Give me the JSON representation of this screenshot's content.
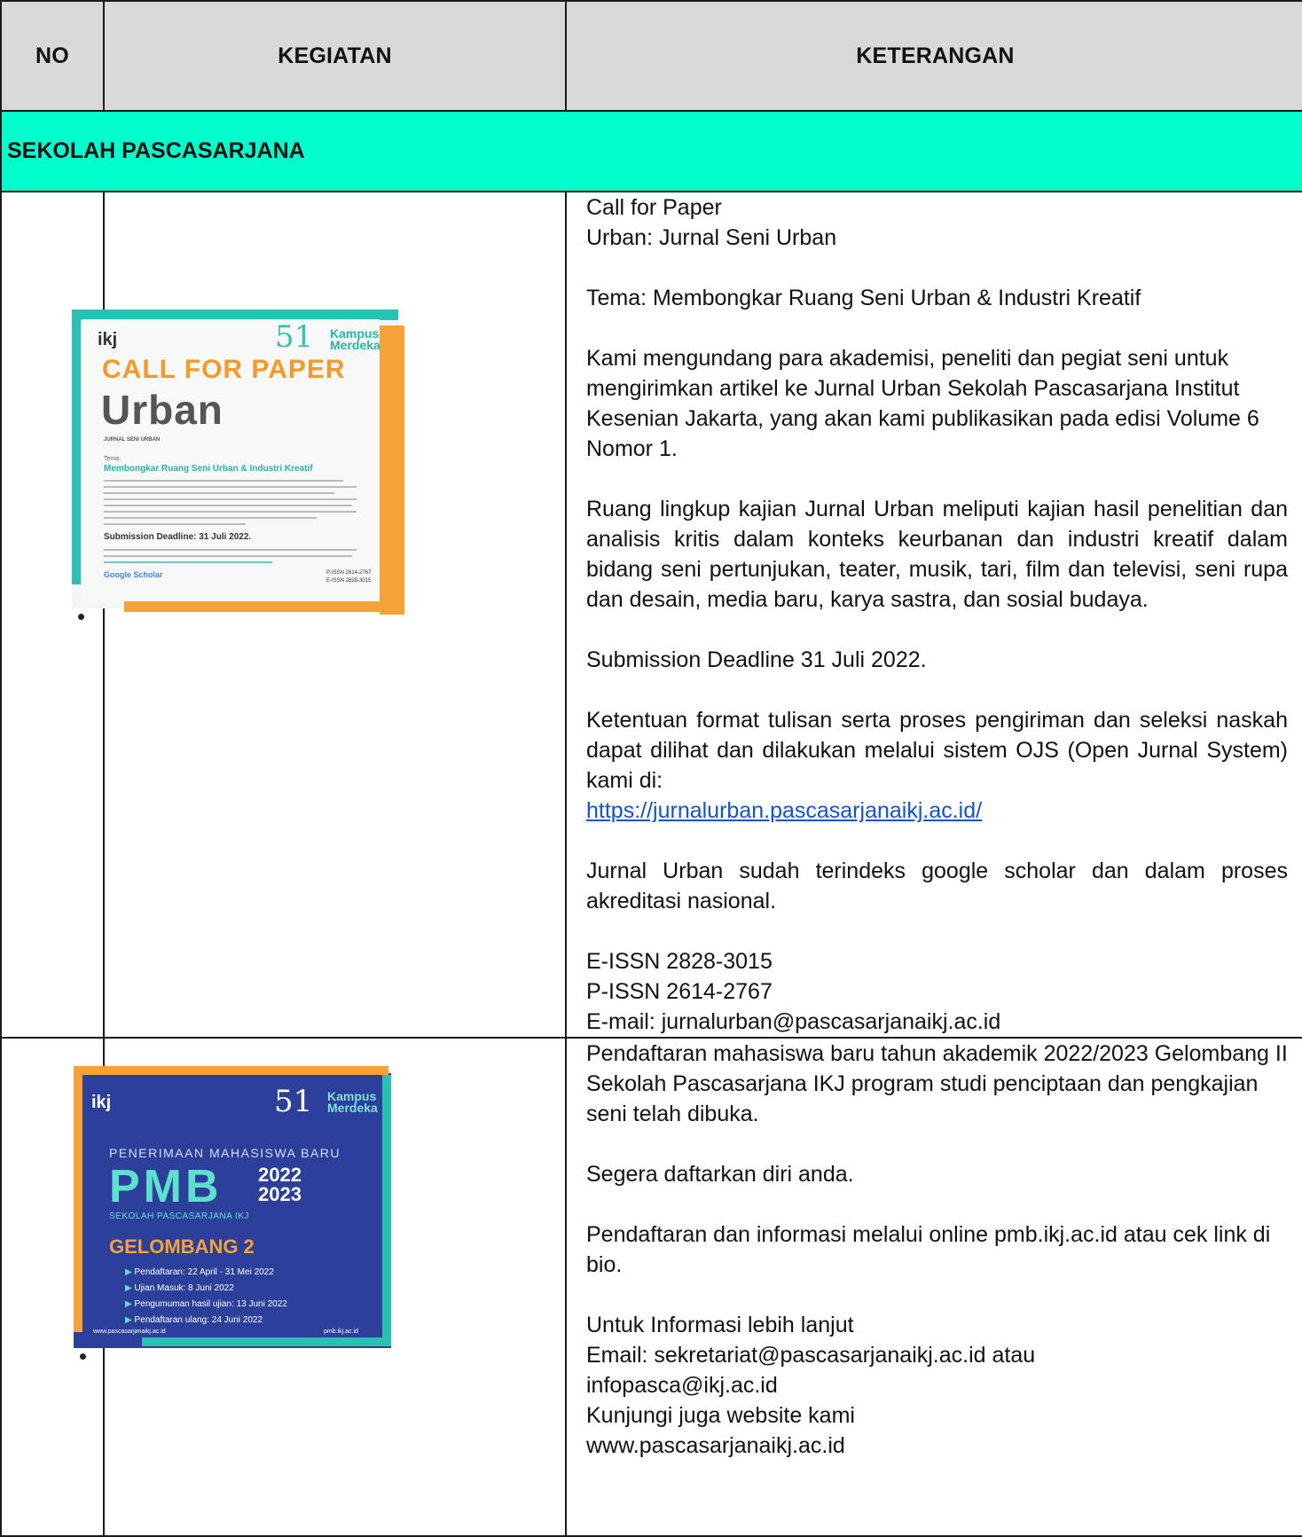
{
  "table": {
    "headers": {
      "no": "NO",
      "kegiatan": "KEGIATAN",
      "keterangan": "KETERANGAN"
    },
    "section_title": "SEKOLAH PASCASARJANA",
    "row1": {
      "lines": {
        "l1": "Call for Paper",
        "l2": "Urban: Jurnal Seni Urban",
        "tema": "Tema: Membongkar Ruang Seni Urban & Industri Kreatif",
        "invite": "Kami mengundang para akademisi, peneliti dan pegiat seni untuk mengirimkan artikel ke Jurnal Urban Sekolah Pascasarjana Institut Kesenian Jakarta, yang akan kami publikasikan pada edisi Volume 6 Nomor 1.",
        "scope": "Ruang lingkup kajian Jurnal Urban meliputi kajian hasil penelitian dan analisis kritis dalam konteks keurbanan dan industri kreatif dalam bidang seni pertunjukan, teater, musik, tari, film dan televisi, seni rupa dan desain, media baru, karya sastra, dan sosial budaya.",
        "deadline": "Submission Deadline 31 Juli 2022.",
        "format": "Ketentuan format tulisan serta proses pengiriman dan seleksi naskah dapat dilihat dan dilakukan melalui sistem OJS (Open Jurnal System) kami di:",
        "link": "https://jurnalurban.pascasarjanaikj.ac.id/",
        "index": "Jurnal Urban sudah terindeks google scholar dan dalam proses akreditasi nasional.",
        "eissn": "E-ISSN 2828-3015",
        "pissn": "P-ISSN 2614-2767",
        "email": "E-mail: jurnalurban@pascasarjanaikj.ac.id"
      },
      "poster": {
        "logo": "ikj",
        "logo_51": "51",
        "kampus": "Kampus",
        "merdeka": "Merdeka",
        "title": "CALL FOR PAPER",
        "urban": "Urban",
        "subtitle": "JURNAL SENI URBAN",
        "tema_label": "Tema:",
        "tema": "Membongkar Ruang Seni Urban & Industri Kreatif",
        "deadline": "Submission Deadline: 31 Juli 2022.",
        "google": "Google Scholar",
        "pissn": "P-ISSN 2614-2767",
        "eissn": "E-ISSN 2828-3015"
      }
    },
    "row2": {
      "lines": {
        "intro": "Pendaftaran mahasiswa baru tahun akademik 2022/2023 Gelombang II Sekolah Pascasarjana IKJ program studi penciptaan dan pengkajian seni telah dibuka.",
        "segera": "Segera daftarkan diri anda.",
        "online": "Pendaftaran dan informasi melalui online pmb.ikj.ac.id atau cek link di bio.",
        "info": "Untuk Informasi lebih lanjut",
        "email": "Email: sekretariat@pascasarjanaikj.ac.id atau",
        "email2": "infopasca@ikj.ac.id",
        "kunjungi": "Kunjungi juga website kami",
        "website": "www.pascasarjanaikj.ac.id"
      },
      "poster": {
        "logo": "ikj",
        "logo_51": "51",
        "kampus": "Kampus",
        "merdeka": "Merdeka",
        "penerimaan": "PENERIMAAN MAHASISWA BARU",
        "pmb": "PMB",
        "year1": "2022",
        "year2": "2023",
        "school": "SEKOLAH PASCASARJANA IKJ",
        "gelombang": "GELOMBANG 2",
        "items": [
          "Pendaftaran: 22 April - 31 Mei 2022",
          "Ujian Masuk: 8 Juni 2022",
          "Pengumuman hasil ujian: 13 Juni 2022",
          "Pendaftaran ulang: 24 Juni 2022"
        ],
        "web": "www.pascasarjanaikj.ac.id",
        "pmb_web": "pmb.ikj.ac.id"
      }
    }
  },
  "colors": {
    "header_bg": "#d9d9d9",
    "section_bg": "#00ffcc",
    "link": "#1155cc",
    "poster2_bg": "#2b3f9b",
    "orange": "#f7a237",
    "teal": "#28c2b5"
  }
}
